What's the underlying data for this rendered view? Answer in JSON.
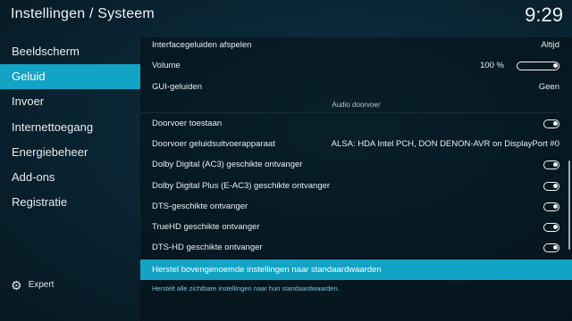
{
  "header": {
    "title": "Instellingen / Systeem",
    "clock": "9:29"
  },
  "sidebar": {
    "items": [
      {
        "label": "Beeldscherm"
      },
      {
        "label": "Geluid"
      },
      {
        "label": "Invoer"
      },
      {
        "label": "Internettoegang"
      },
      {
        "label": "Energiebeheer"
      },
      {
        "label": "Add-ons"
      },
      {
        "label": "Registratie"
      }
    ],
    "active_index": 1,
    "expert_label": "Expert"
  },
  "settings": {
    "interface_sounds": {
      "label": "Interfacegeluiden afspelen",
      "value": "Altijd"
    },
    "volume": {
      "label": "Volume",
      "value": "100 %",
      "level": 1.0
    },
    "gui_sounds": {
      "label": "GUI-geluiden",
      "value": "Geen"
    },
    "section_audio_passthrough": "Audio doorvoer",
    "passthrough": {
      "label": "Doorvoer toestaan",
      "enabled": true
    },
    "passthrough_device": {
      "label": "Doorvoer geluidsuitvoerapparaat",
      "value": "ALSA: HDA Intel PCH, DON DENON-AVR on DisplayPort #0"
    },
    "ac3": {
      "label": "Dolby Digital (AC3) geschikte ontvanger",
      "enabled": true
    },
    "eac3": {
      "label": "Dolby Digital Plus (E-AC3) geschikte ontvanger",
      "enabled": true
    },
    "dts": {
      "label": "DTS-geschikte ontvanger",
      "enabled": true
    },
    "truehd": {
      "label": "TrueHD geschikte ontvanger",
      "enabled": true
    },
    "dtshd": {
      "label": "DTS-HD geschikte ontvanger",
      "enabled": true
    },
    "reset": {
      "label": "Herstel bovengenoemde instellingen naar standaardwaarden"
    },
    "hint": "Herstelt alle zichtbare instellingen naar hun standaardwaarden."
  },
  "colors": {
    "accent": "#12a3c5",
    "hint_text": "#7fc7dc"
  },
  "icons": {
    "expert": "gear-icon",
    "toggle": "toggle-on-icon"
  }
}
